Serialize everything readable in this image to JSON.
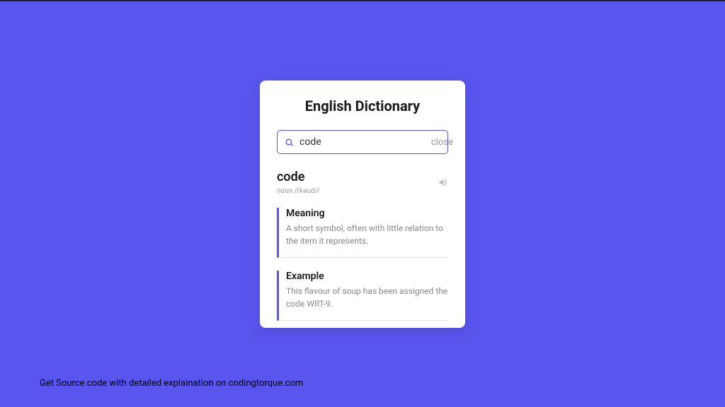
{
  "card": {
    "title": "English Dictionary",
    "search": {
      "value": "code",
      "close_label": "close"
    },
    "word": {
      "text": "code",
      "meta": "noun //kəʊd//"
    },
    "meaning": {
      "title": "Meaning",
      "body": "A short symbol, often with little relation to the item it represents."
    },
    "example": {
      "title": "Example",
      "body": "This flavour of soup has been assigned the code WRT-9."
    }
  },
  "footer": "Get Source code with detailed explaination on codingtorque.com"
}
